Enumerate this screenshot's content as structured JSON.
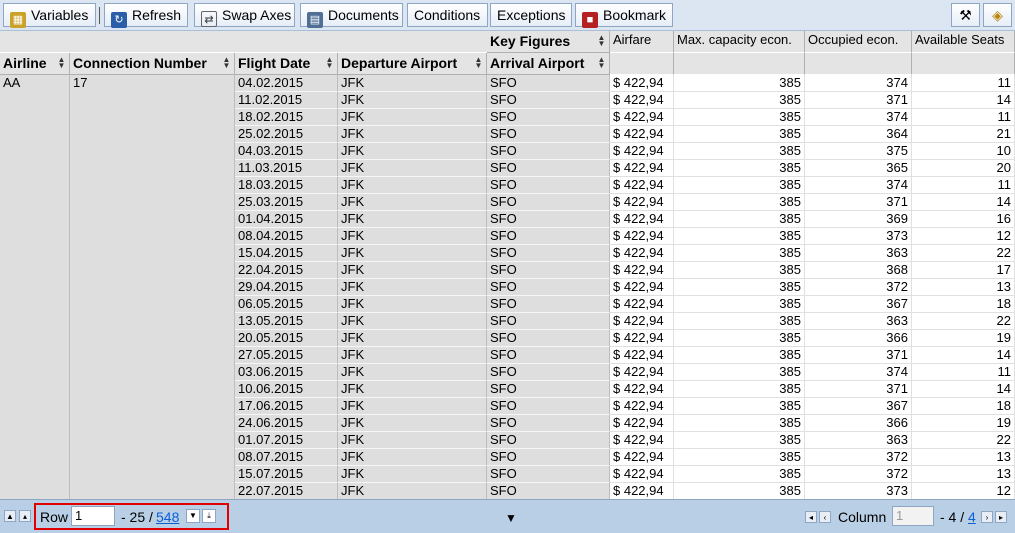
{
  "toolbar": {
    "variables": "Variables",
    "refresh": "Refresh",
    "swap_axes": "Swap Axes",
    "documents": "Documents",
    "conditions": "Conditions",
    "exceptions": "Exceptions",
    "bookmark": "Bookmark"
  },
  "table": {
    "key_figures_label": "Key Figures",
    "row_headers": [
      "Airline",
      "Connection Number",
      "Flight Date",
      "Departure Airport",
      "Arrival Airport"
    ],
    "key_figures": [
      "Airfare",
      "Max. capacity econ.",
      "Occupied econ.",
      "Available Seats"
    ],
    "airline": "AA",
    "connection_number": "17",
    "rows": [
      {
        "date": "04.02.2015",
        "dep": "JFK",
        "arr": "SFO",
        "fare": "$ 422,94",
        "max": "385",
        "occ": "374",
        "avail": "11"
      },
      {
        "date": "11.02.2015",
        "dep": "JFK",
        "arr": "SFO",
        "fare": "$ 422,94",
        "max": "385",
        "occ": "371",
        "avail": "14"
      },
      {
        "date": "18.02.2015",
        "dep": "JFK",
        "arr": "SFO",
        "fare": "$ 422,94",
        "max": "385",
        "occ": "374",
        "avail": "11"
      },
      {
        "date": "25.02.2015",
        "dep": "JFK",
        "arr": "SFO",
        "fare": "$ 422,94",
        "max": "385",
        "occ": "364",
        "avail": "21"
      },
      {
        "date": "04.03.2015",
        "dep": "JFK",
        "arr": "SFO",
        "fare": "$ 422,94",
        "max": "385",
        "occ": "375",
        "avail": "10"
      },
      {
        "date": "11.03.2015",
        "dep": "JFK",
        "arr": "SFO",
        "fare": "$ 422,94",
        "max": "385",
        "occ": "365",
        "avail": "20"
      },
      {
        "date": "18.03.2015",
        "dep": "JFK",
        "arr": "SFO",
        "fare": "$ 422,94",
        "max": "385",
        "occ": "374",
        "avail": "11"
      },
      {
        "date": "25.03.2015",
        "dep": "JFK",
        "arr": "SFO",
        "fare": "$ 422,94",
        "max": "385",
        "occ": "371",
        "avail": "14"
      },
      {
        "date": "01.04.2015",
        "dep": "JFK",
        "arr": "SFO",
        "fare": "$ 422,94",
        "max": "385",
        "occ": "369",
        "avail": "16"
      },
      {
        "date": "08.04.2015",
        "dep": "JFK",
        "arr": "SFO",
        "fare": "$ 422,94",
        "max": "385",
        "occ": "373",
        "avail": "12"
      },
      {
        "date": "15.04.2015",
        "dep": "JFK",
        "arr": "SFO",
        "fare": "$ 422,94",
        "max": "385",
        "occ": "363",
        "avail": "22"
      },
      {
        "date": "22.04.2015",
        "dep": "JFK",
        "arr": "SFO",
        "fare": "$ 422,94",
        "max": "385",
        "occ": "368",
        "avail": "17"
      },
      {
        "date": "29.04.2015",
        "dep": "JFK",
        "arr": "SFO",
        "fare": "$ 422,94",
        "max": "385",
        "occ": "372",
        "avail": "13"
      },
      {
        "date": "06.05.2015",
        "dep": "JFK",
        "arr": "SFO",
        "fare": "$ 422,94",
        "max": "385",
        "occ": "367",
        "avail": "18"
      },
      {
        "date": "13.05.2015",
        "dep": "JFK",
        "arr": "SFO",
        "fare": "$ 422,94",
        "max": "385",
        "occ": "363",
        "avail": "22"
      },
      {
        "date": "20.05.2015",
        "dep": "JFK",
        "arr": "SFO",
        "fare": "$ 422,94",
        "max": "385",
        "occ": "366",
        "avail": "19"
      },
      {
        "date": "27.05.2015",
        "dep": "JFK",
        "arr": "SFO",
        "fare": "$ 422,94",
        "max": "385",
        "occ": "371",
        "avail": "14"
      },
      {
        "date": "03.06.2015",
        "dep": "JFK",
        "arr": "SFO",
        "fare": "$ 422,94",
        "max": "385",
        "occ": "374",
        "avail": "11"
      },
      {
        "date": "10.06.2015",
        "dep": "JFK",
        "arr": "SFO",
        "fare": "$ 422,94",
        "max": "385",
        "occ": "371",
        "avail": "14"
      },
      {
        "date": "17.06.2015",
        "dep": "JFK",
        "arr": "SFO",
        "fare": "$ 422,94",
        "max": "385",
        "occ": "367",
        "avail": "18"
      },
      {
        "date": "24.06.2015",
        "dep": "JFK",
        "arr": "SFO",
        "fare": "$ 422,94",
        "max": "385",
        "occ": "366",
        "avail": "19"
      },
      {
        "date": "01.07.2015",
        "dep": "JFK",
        "arr": "SFO",
        "fare": "$ 422,94",
        "max": "385",
        "occ": "363",
        "avail": "22"
      },
      {
        "date": "08.07.2015",
        "dep": "JFK",
        "arr": "SFO",
        "fare": "$ 422,94",
        "max": "385",
        "occ": "372",
        "avail": "13"
      },
      {
        "date": "15.07.2015",
        "dep": "JFK",
        "arr": "SFO",
        "fare": "$ 422,94",
        "max": "385",
        "occ": "372",
        "avail": "13"
      },
      {
        "date": "22.07.2015",
        "dep": "JFK",
        "arr": "SFO",
        "fare": "$ 422,94",
        "max": "385",
        "occ": "373",
        "avail": "12"
      }
    ]
  },
  "footer": {
    "row_label": "Row",
    "row_value": "1",
    "row_range": "- 25 /",
    "row_total": "548",
    "column_label": "Column",
    "column_value": "1",
    "column_range": "- 4 /",
    "column_total": "4"
  },
  "colors": {
    "toolbar_bg": "#dbe6f2",
    "footer_bg": "#b9cfe6",
    "header_bg": "#e4e4e4",
    "highlight_border": "#e00000",
    "link": "#0a5fd6"
  }
}
